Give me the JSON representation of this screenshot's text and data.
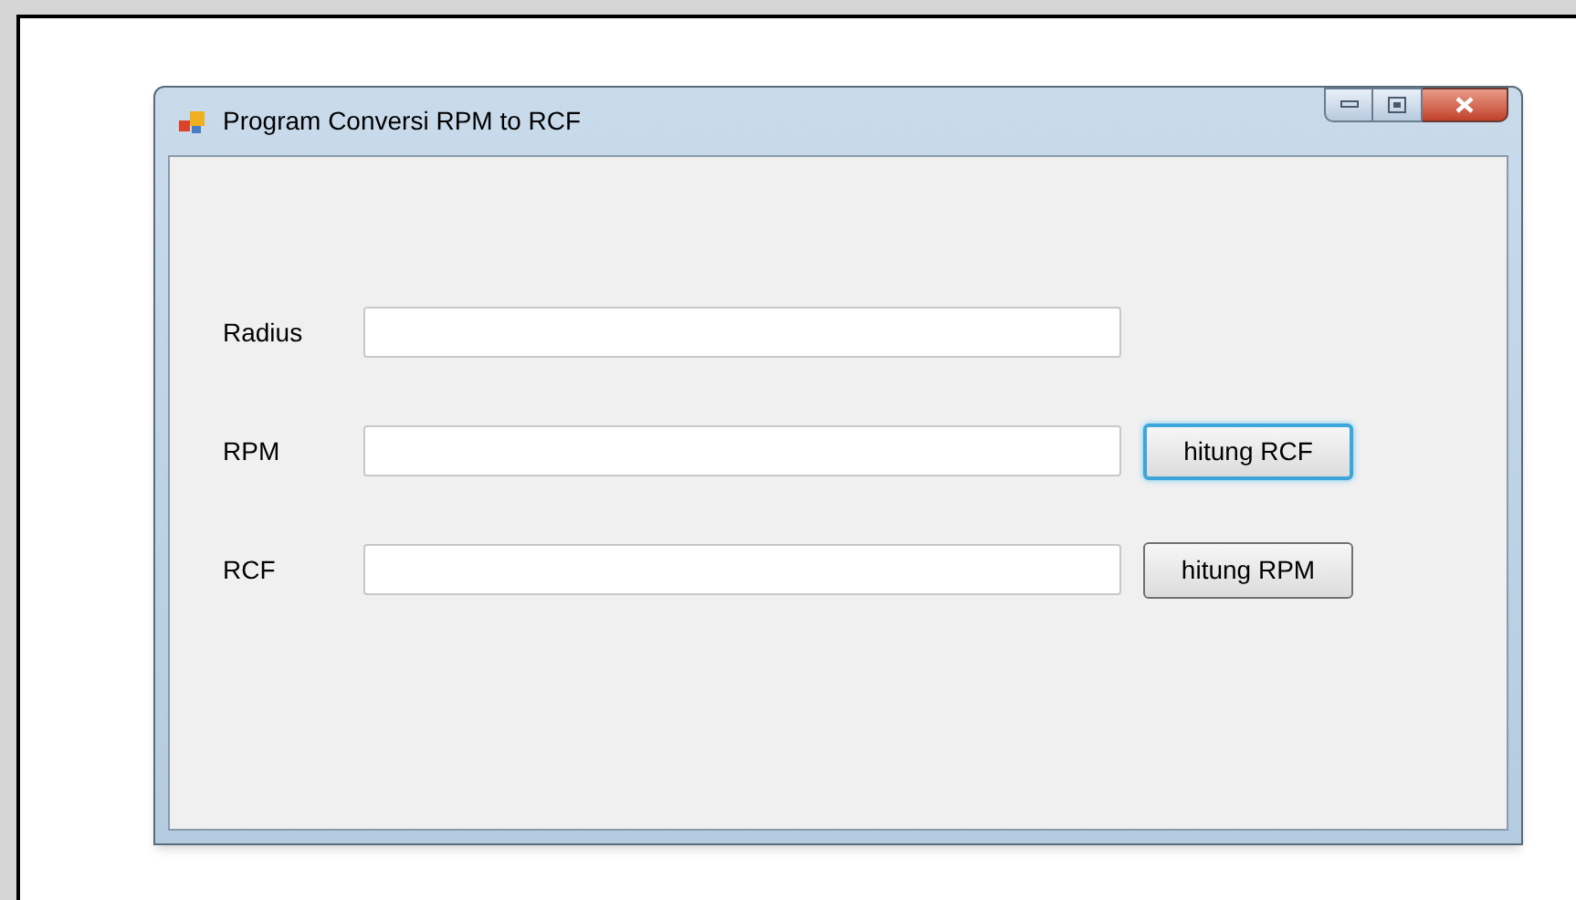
{
  "window": {
    "title": "Program Conversi RPM to RCF"
  },
  "rows": [
    {
      "label": "Radius",
      "value": ""
    },
    {
      "label": "RPM",
      "value": "",
      "button": {
        "label": "hitung RCF",
        "focused": true
      }
    },
    {
      "label": "RCF",
      "value": "",
      "button": {
        "label": "hitung RPM",
        "focused": false
      }
    }
  ]
}
